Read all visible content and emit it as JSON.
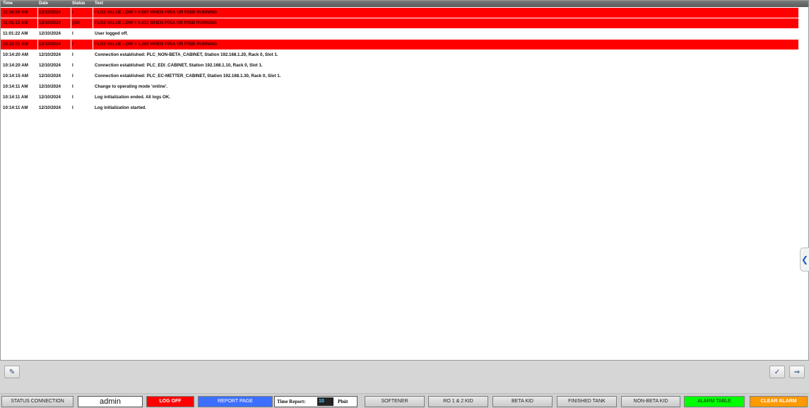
{
  "log": {
    "columns": {
      "time": "Time",
      "date": "Date",
      "status": "Status",
      "text": "Text"
    },
    "rows": [
      {
        "time": "11:16:59 AM",
        "date": "12/10/2024",
        "status": "I",
        "text": "FLO3 VALUE LOW = 0.087 WHEN P05A OR P05B RUNNING",
        "alarm": true
      },
      {
        "time": "11:05:12 AM",
        "date": "12/10/2024",
        "status": "(I)O",
        "text": "FLO3 VALUE LOW = 0.311 WHEN P05A OR P05B RUNNING",
        "alarm": true
      },
      {
        "time": "11:01:22 AM",
        "date": "12/10/2024",
        "status": "I",
        "text": "User logged off.",
        "alarm": false
      },
      {
        "time": "10:23:01 AM",
        "date": "12/10/2024",
        "status": "I",
        "text": "FLO3 VALUE LOW = 1.302 WHEN P05A OR P05B RUNNING",
        "alarm": true
      },
      {
        "time": "10:14:20 AM",
        "date": "12/10/2024",
        "status": "I",
        "text": "Connection established: PLC_NON-BETA_CABINET, Station 192.168.1.20, Rack 0, Slot 1.",
        "alarm": false
      },
      {
        "time": "10:14:20 AM",
        "date": "12/10/2024",
        "status": "I",
        "text": "Connection established: PLC_EDI_CABINET, Station 192.168.1.10, Rack 0, Slot 1.",
        "alarm": false
      },
      {
        "time": "10:14:15 AM",
        "date": "12/10/2024",
        "status": "I",
        "text": "Connection established: PLC_EC-METTER_CABINET, Station 192.168.1.30, Rack 0, Slot 1.",
        "alarm": false
      },
      {
        "time": "10:14:11 AM",
        "date": "12/10/2024",
        "status": "I",
        "text": "Change to operating mode 'online'.",
        "alarm": false
      },
      {
        "time": "10:14:11 AM",
        "date": "12/10/2024",
        "status": "I",
        "text": "Log initialization ended. All logs OK.",
        "alarm": false
      },
      {
        "time": "10:14:11 AM",
        "date": "12/10/2024",
        "status": "I",
        "text": "Log initialization started.",
        "alarm": false
      }
    ],
    "alarm_color": "#ff0000"
  },
  "side_tab": {
    "icon": "chevron-left-icon",
    "glyph": "❮"
  },
  "tools": {
    "left": {
      "icon": "edit-list-icon",
      "glyph": "✎"
    },
    "right1": {
      "icon": "acknowledge-icon",
      "glyph": "✓"
    },
    "right2": {
      "icon": "export-icon",
      "glyph": "⇒"
    }
  },
  "nav": {
    "status_connection": "STATUS CONNECTION",
    "user": "admin",
    "log_off": "LOG OFF",
    "report_page": "REPORT PAGE",
    "time_report_label": "Time Report:",
    "time_report_value": "10",
    "time_report_unit": "Phút",
    "softener": "SOFTENER",
    "ro": "RO 1 & 2 KID",
    "beta": "BETA KID",
    "finished_tank": "FINISHED TANK",
    "non_beta": "NON-BETA KID",
    "alarm_table": "ALARM TABLE",
    "clear_alarm": "CLEAR ALARM",
    "colors": {
      "log_off": "#ff0000",
      "report_page": "#3d6fff",
      "alarm_table": "#00ff00",
      "clear_alarm": "#ff9900"
    }
  }
}
